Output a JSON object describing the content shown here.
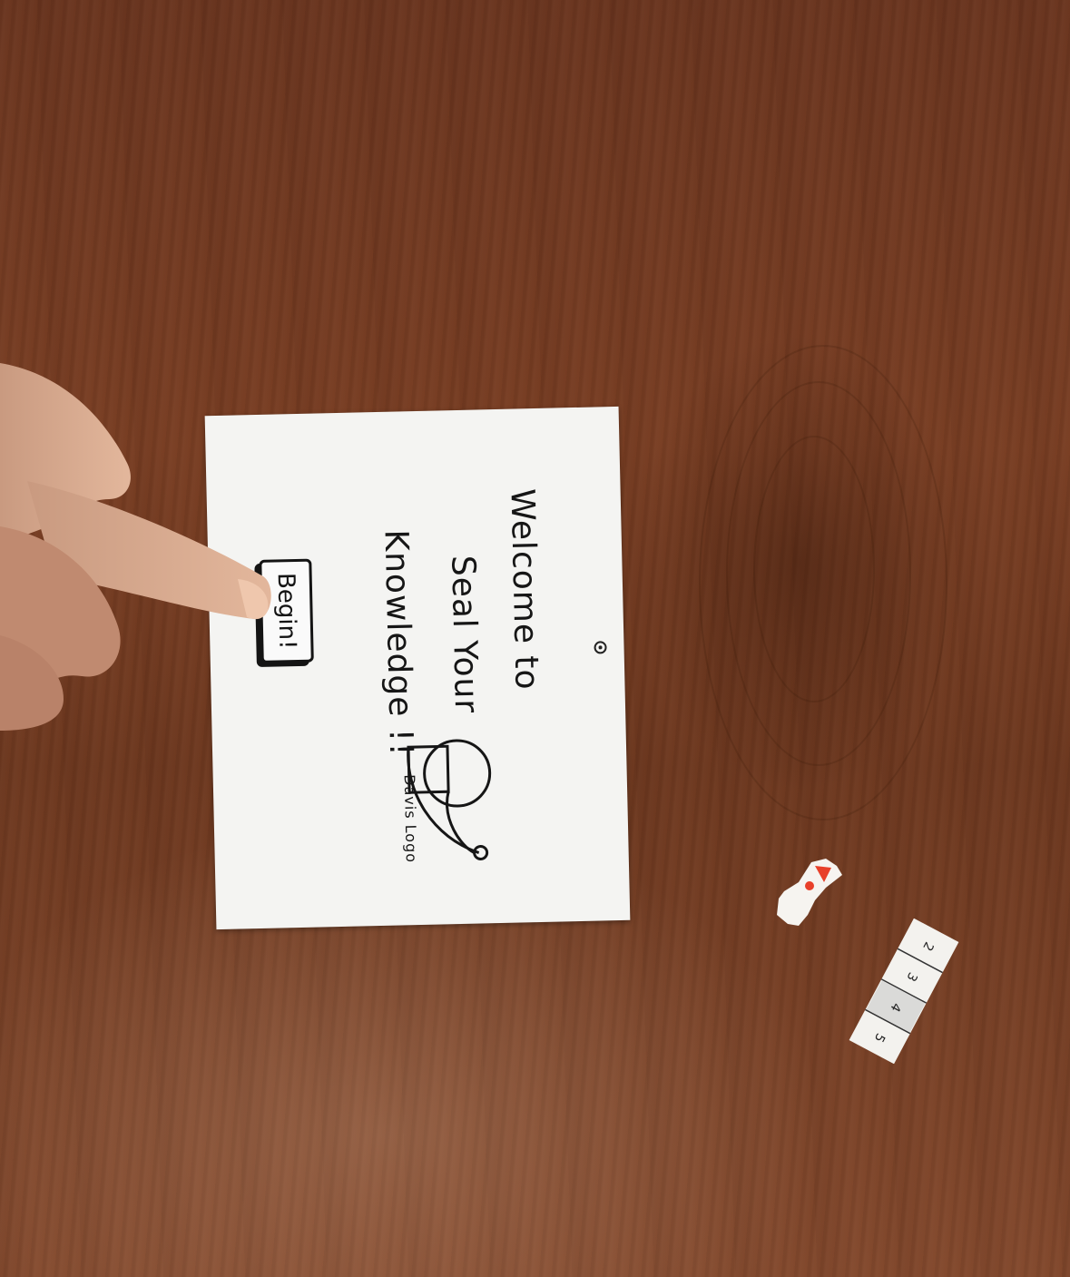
{
  "welcome_card": {
    "line1": "Welcome to",
    "line2": "Seal Your",
    "line3": "Knowledge !!",
    "logo_caption": "Davis Logo",
    "begin_button_label": "Begin!"
  },
  "rating_strip": {
    "options": [
      "2",
      "3",
      "4",
      "5"
    ],
    "selected": "4"
  },
  "colors": {
    "table": "#6e3920",
    "paper": "#f4f4f2",
    "ink": "#161616",
    "exclaim_red": "#e8402a"
  },
  "icons": {
    "camera": "camera-dot-icon",
    "logo": "davis-seal-logo-icon",
    "alert": "exclamation-icon"
  }
}
